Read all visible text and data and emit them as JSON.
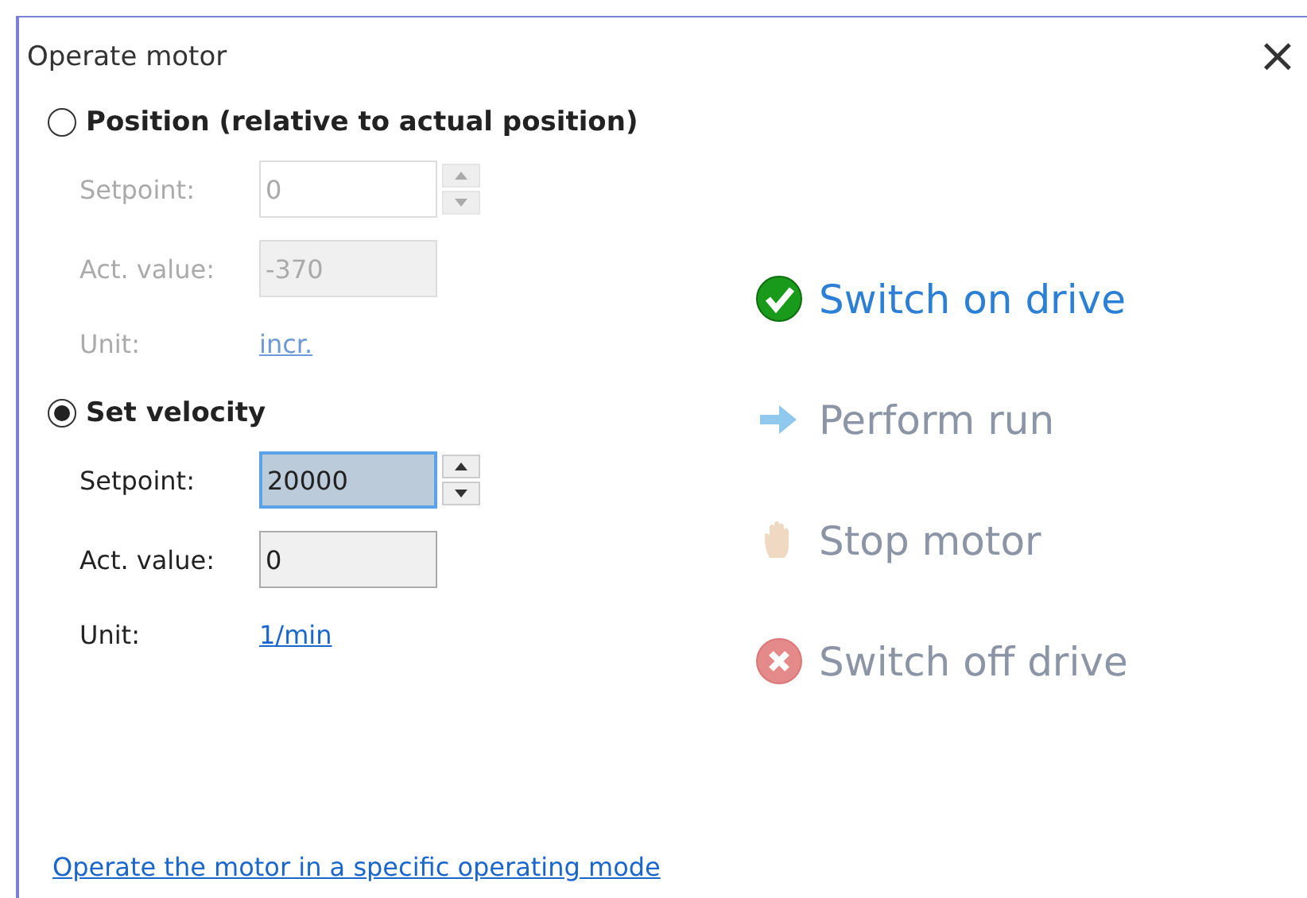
{
  "window": {
    "title": "Operate motor",
    "close": "×"
  },
  "modes": [
    {
      "label": "Position (relative to actual position)",
      "selected": false,
      "disabled": true,
      "setpoint_label": "Setpoint:",
      "setpoint": "0",
      "setpoint_focused": false,
      "actual_label": "Act. value:",
      "actual": "-370",
      "unit_label": "Unit:",
      "unit": "incr."
    },
    {
      "label": "Set velocity",
      "selected": true,
      "disabled": false,
      "setpoint_label": "Setpoint:",
      "setpoint": "20000",
      "setpoint_focused": true,
      "actual_label": "Act. value:",
      "actual": "0",
      "unit_label": "Unit:",
      "unit": "1/min"
    }
  ],
  "actions": [
    {
      "kind": "check",
      "label": "Switch on drive",
      "disabled": false
    },
    {
      "kind": "arrow",
      "label": "Perform run",
      "disabled": true
    },
    {
      "kind": "hand",
      "label": "Stop motor",
      "disabled": true
    },
    {
      "kind": "cross",
      "label": "Switch off drive",
      "disabled": true
    }
  ],
  "help_link": "Operate the motor in a specific operating mode"
}
